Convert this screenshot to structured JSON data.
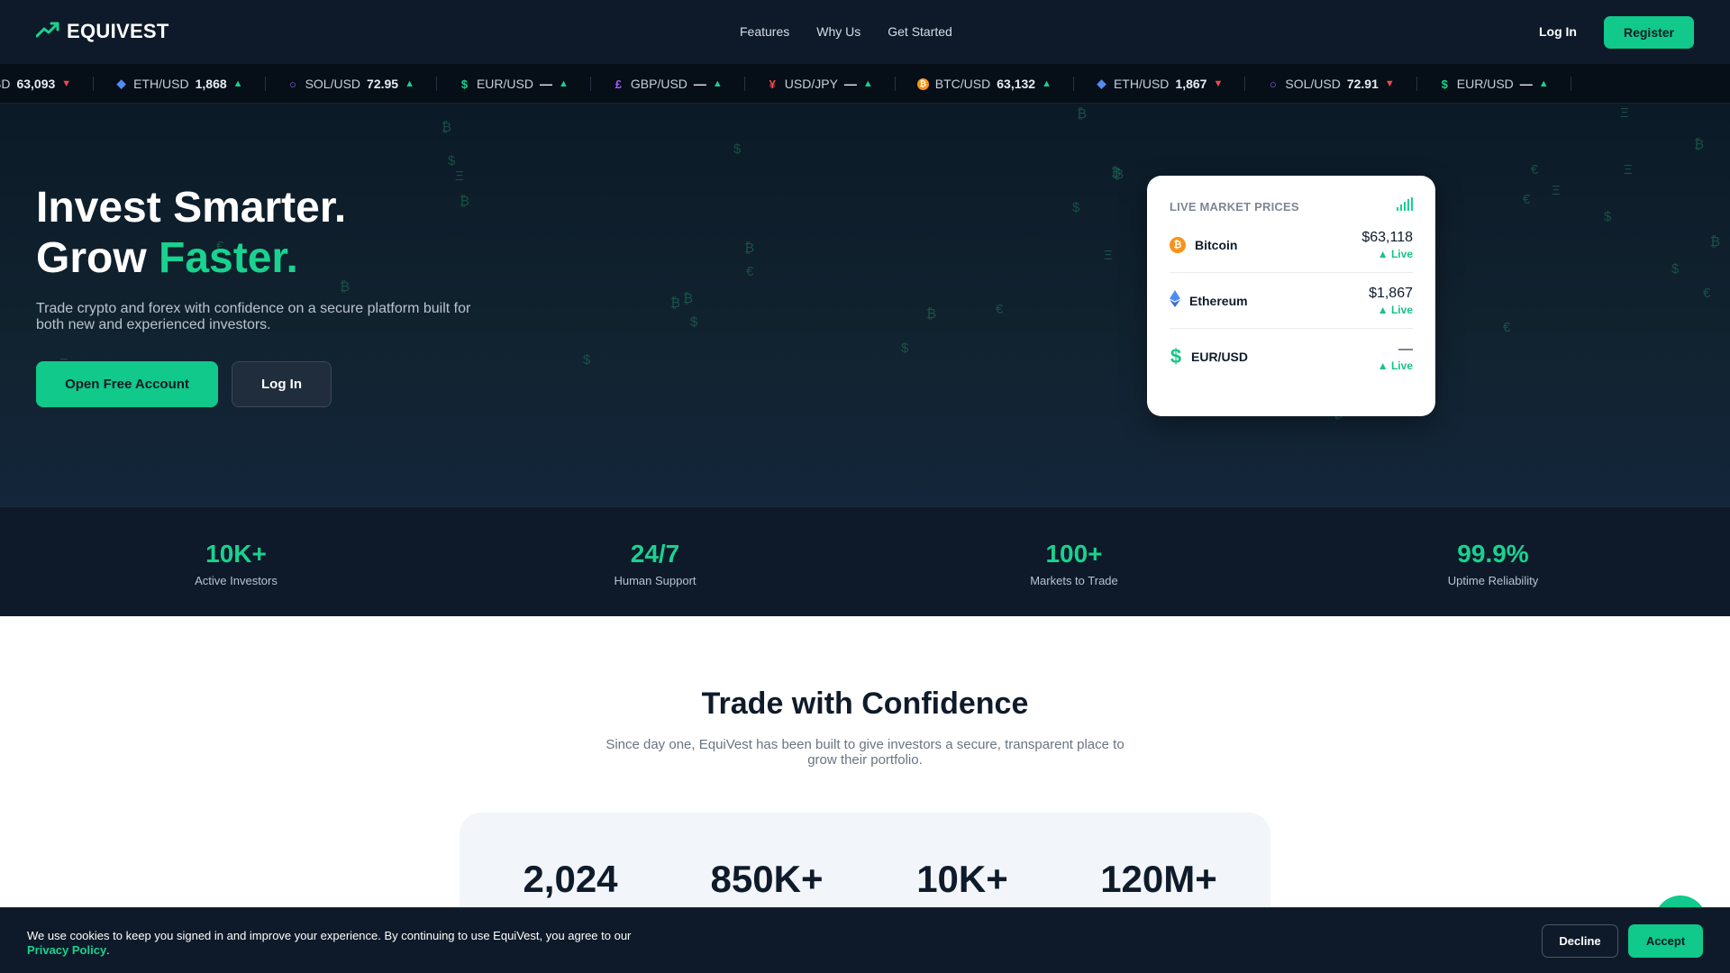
{
  "brand": {
    "name": "EQUIVEST",
    "accent": "#19d28f",
    "dark": "#0e1a29"
  },
  "nav": {
    "links": [
      "Features",
      "Why Us",
      "Get Started"
    ],
    "login": "Log In",
    "register": "Register"
  },
  "ticker": [
    {
      "icon": "bitcoin-icon",
      "symbol": "BTC/USD",
      "visible_symbol": "SD",
      "price": "63,093",
      "dir": "down"
    },
    {
      "icon": "ethereum-icon",
      "symbol": "ETH/USD",
      "price": "1,868",
      "dir": "up"
    },
    {
      "icon": "solana-icon",
      "symbol": "SOL/USD",
      "price": "72.95",
      "dir": "up"
    },
    {
      "icon": "dollar-icon",
      "symbol": "EUR/USD",
      "price": "—",
      "dir": "up"
    },
    {
      "icon": "pound-icon",
      "symbol": "GBP/USD",
      "price": "—",
      "dir": "up"
    },
    {
      "icon": "yen-icon",
      "symbol": "USD/JPY",
      "price": "—",
      "dir": "up"
    },
    {
      "icon": "bitcoin-icon",
      "symbol": "BTC/USD",
      "price": "63,132",
      "dir": "up"
    },
    {
      "icon": "ethereum-icon",
      "symbol": "ETH/USD",
      "price": "1,867",
      "dir": "down"
    },
    {
      "icon": "solana-icon",
      "symbol": "SOL/USD",
      "price": "72.91",
      "dir": "down"
    },
    {
      "icon": "dollar-icon",
      "symbol": "EUR/USD",
      "price": "—",
      "dir": "up"
    }
  ],
  "hero": {
    "title_line1": "Invest Smarter.",
    "title_line2_plain": "Grow ",
    "title_line2_accent": "Faster.",
    "subtitle": "Trade crypto and forex with confidence on a secure platform built for both new and experienced investors.",
    "cta_primary": "Open Free Account",
    "cta_secondary": "Log In"
  },
  "market_card": {
    "title": "LIVE MARKET PRICES",
    "rows": [
      {
        "icon": "bitcoin-icon",
        "name": "Bitcoin",
        "price": "$63,118",
        "live": "▲ Live"
      },
      {
        "icon": "ethereum-icon",
        "name": "Ethereum",
        "price": "$1,867",
        "live": "▲ Live"
      },
      {
        "icon": "dollar-icon",
        "name": "EUR/USD",
        "price": "—",
        "live": "▲ Live"
      }
    ]
  },
  "stats": [
    {
      "value": "10K+",
      "label": "Active Investors"
    },
    {
      "value": "24/7",
      "label": "Human Support"
    },
    {
      "value": "100+",
      "label": "Markets to Trade"
    },
    {
      "value": "99.9%",
      "label": "Uptime Reliability"
    }
  ],
  "confidence": {
    "title": "Trade with Confidence",
    "subtitle": "Since day one, EquiVest has been built to give investors a secure, transparent place to grow their portfolio.",
    "values": [
      "2,024",
      "850K+",
      "10K+",
      "120M+"
    ]
  },
  "cookie": {
    "text": "We use cookies to keep you signed in and improve your experience. By continuing to use EquiVest, you agree to our",
    "link": "Privacy Policy",
    "decline": "Decline",
    "accept": "Accept"
  }
}
